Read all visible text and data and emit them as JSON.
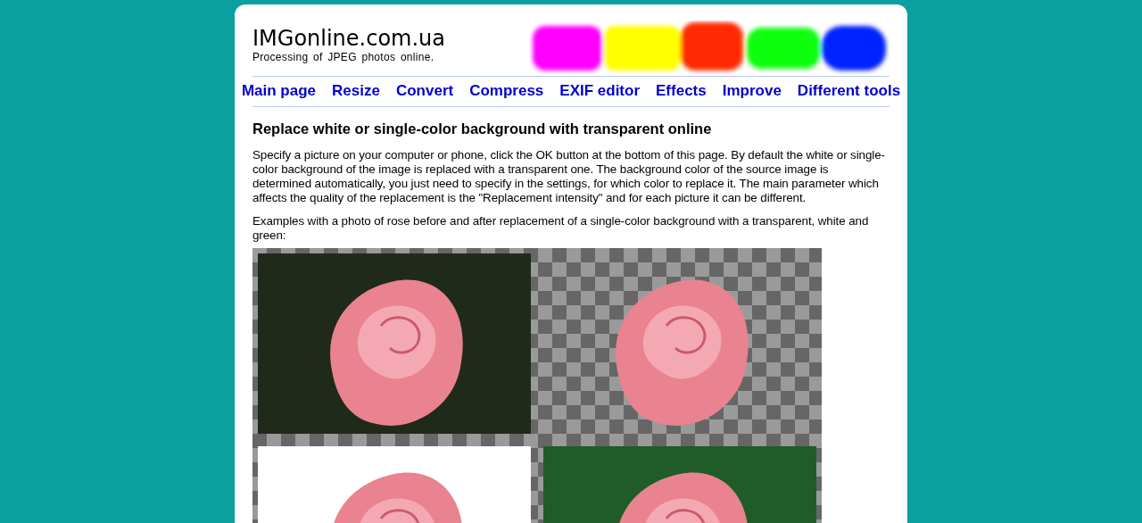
{
  "header": {
    "logo": "IMGonline.com.ua",
    "tagline": "Processing of JPEG photos online."
  },
  "nav": [
    {
      "label": "Main page"
    },
    {
      "label": "Resize"
    },
    {
      "label": "Convert"
    },
    {
      "label": "Compress"
    },
    {
      "label": "EXIF editor"
    },
    {
      "label": "Effects"
    },
    {
      "label": "Improve"
    },
    {
      "label": "Different tools"
    }
  ],
  "article": {
    "title": "Replace white or single-color background with transparent online",
    "intro": "Specify a picture on your computer or phone, click the OK button at the bottom of this page. By default the white or single-color background of the image is replaced with a transparent one. The background color of the source image is determined automatically, you just need to specify in the settings, for which color to replace it. The main parameter which affects the quality of the replacement is the \"Replacement intensity\" and for each picture it can be different.",
    "examples_caption": "Examples with a photo of rose before and after replacement of a single-color background with a transparent, white and green:"
  },
  "examples": [
    {
      "kind": "original"
    },
    {
      "kind": "transparent"
    },
    {
      "kind": "white"
    },
    {
      "kind": "green"
    }
  ]
}
